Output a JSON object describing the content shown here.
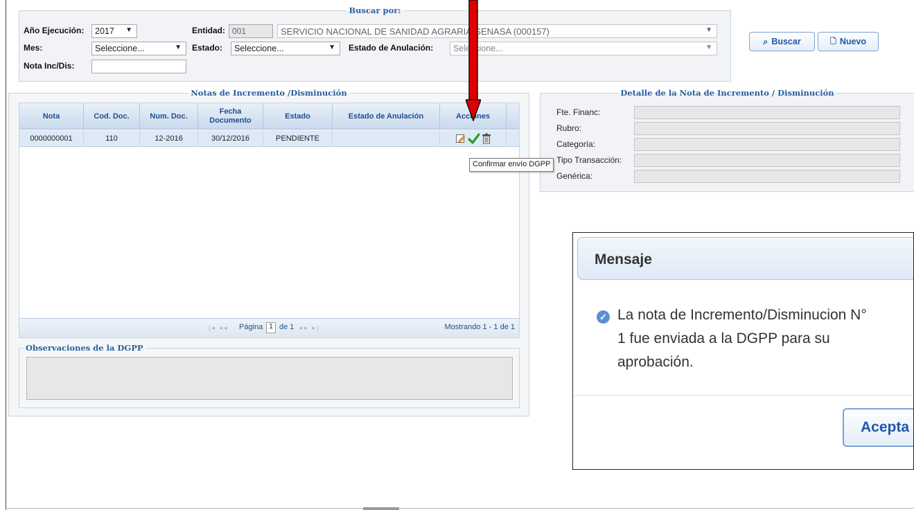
{
  "search": {
    "legend": "Buscar por:",
    "anio_label": "Año Ejecución:",
    "anio_value": "2017",
    "entidad_label": "Entidad:",
    "entidad_code": "001",
    "entidad_name": "SERVICIO NACIONAL DE SANIDAD AGRARIA-SENASA (000157)",
    "mes_label": "Mes:",
    "mes_value": "Seleccione...",
    "estado_label": "Estado:",
    "estado_value": "Seleccione...",
    "anulacion_label": "Estado de Anulación:",
    "anulacion_value": "Seleccione...",
    "nota_label": "Nota Inc/Dis:",
    "nota_value": "",
    "buscar_label": "Buscar",
    "nuevo_label": "Nuevo"
  },
  "notas": {
    "legend": "Notas de Incremento /Disminución",
    "columns": [
      "Nota",
      "Cod. Doc.",
      "Num. Doc.",
      "Fecha Documento",
      "Estado",
      "Estado de Anulación",
      "Acciones"
    ],
    "rows": [
      {
        "nota": "0000000001",
        "cod_doc": "110",
        "num_doc": "12-2016",
        "fecha": "30/12/2016",
        "estado": "PENDIENTE",
        "anulacion": ""
      }
    ],
    "pager": {
      "page_label": "Página",
      "page": "1",
      "of_label": "de 1",
      "showing": "Mostrando 1 - 1 de 1"
    }
  },
  "observaciones": {
    "legend": "Observaciones de la DGPP"
  },
  "detalle": {
    "legend": "Detalle de la Nota de Incremento / Disminución",
    "fields": [
      "Fte. Financ:",
      "Rubro:",
      "Categoría:",
      "Tipo Transacción:",
      "Genérica:"
    ]
  },
  "tooltip": "Confirmar envío DGPP",
  "dialog": {
    "title": "Mensaje",
    "line1": "La nota de Incremento/Disminucion N°",
    "line2": "1 fue enviada a la DGPP para su",
    "line3": "aprobación.",
    "button": "Acepta"
  },
  "icons": [
    "search-icon",
    "new-document-icon",
    "edit-icon",
    "check-icon",
    "trash-icon",
    "info-icon",
    "red-arrow-icon"
  ],
  "colors": {
    "accent": "#1f57a8",
    "legend": "#2a5f9e",
    "arrow": "#e00000",
    "row_selected": "#dde9f7"
  }
}
